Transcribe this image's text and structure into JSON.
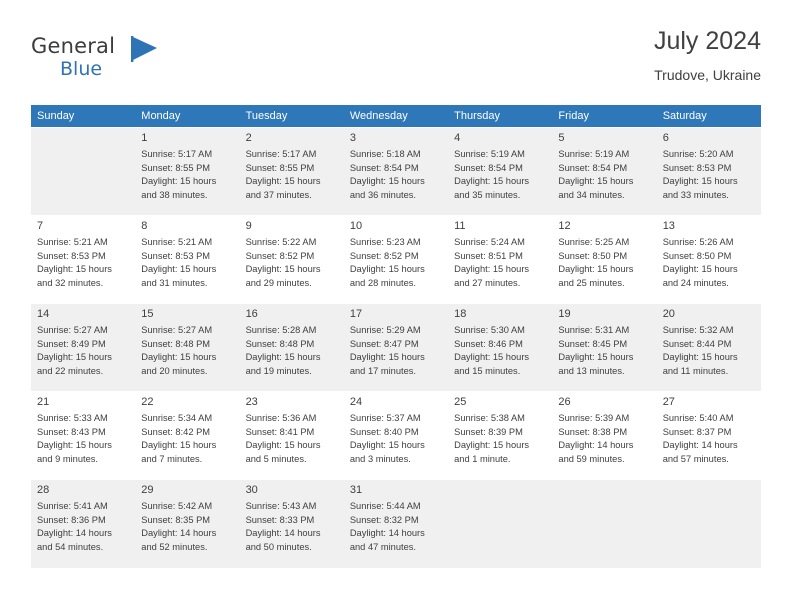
{
  "brand": {
    "name_primary": "General",
    "name_secondary": "Blue",
    "flag_icon": "flag-icon"
  },
  "header": {
    "title": "July 2024",
    "subtitle": "Trudove, Ukraine"
  },
  "colors": {
    "header_row": "#2e77b8",
    "brand_blue": "#2e74b5",
    "shaded_row": "#f0f0f0",
    "text": "#3f3f3f"
  },
  "weekdays": [
    "Sunday",
    "Monday",
    "Tuesday",
    "Wednesday",
    "Thursday",
    "Friday",
    "Saturday"
  ],
  "weeks": [
    [
      {
        "day": "",
        "detail": ""
      },
      {
        "day": "1",
        "detail": "Sunrise: 5:17 AM\nSunset: 8:55 PM\nDaylight: 15 hours\nand 38 minutes."
      },
      {
        "day": "2",
        "detail": "Sunrise: 5:17 AM\nSunset: 8:55 PM\nDaylight: 15 hours\nand 37 minutes."
      },
      {
        "day": "3",
        "detail": "Sunrise: 5:18 AM\nSunset: 8:54 PM\nDaylight: 15 hours\nand 36 minutes."
      },
      {
        "day": "4",
        "detail": "Sunrise: 5:19 AM\nSunset: 8:54 PM\nDaylight: 15 hours\nand 35 minutes."
      },
      {
        "day": "5",
        "detail": "Sunrise: 5:19 AM\nSunset: 8:54 PM\nDaylight: 15 hours\nand 34 minutes."
      },
      {
        "day": "6",
        "detail": "Sunrise: 5:20 AM\nSunset: 8:53 PM\nDaylight: 15 hours\nand 33 minutes."
      }
    ],
    [
      {
        "day": "7",
        "detail": "Sunrise: 5:21 AM\nSunset: 8:53 PM\nDaylight: 15 hours\nand 32 minutes."
      },
      {
        "day": "8",
        "detail": "Sunrise: 5:21 AM\nSunset: 8:53 PM\nDaylight: 15 hours\nand 31 minutes."
      },
      {
        "day": "9",
        "detail": "Sunrise: 5:22 AM\nSunset: 8:52 PM\nDaylight: 15 hours\nand 29 minutes."
      },
      {
        "day": "10",
        "detail": "Sunrise: 5:23 AM\nSunset: 8:52 PM\nDaylight: 15 hours\nand 28 minutes."
      },
      {
        "day": "11",
        "detail": "Sunrise: 5:24 AM\nSunset: 8:51 PM\nDaylight: 15 hours\nand 27 minutes."
      },
      {
        "day": "12",
        "detail": "Sunrise: 5:25 AM\nSunset: 8:50 PM\nDaylight: 15 hours\nand 25 minutes."
      },
      {
        "day": "13",
        "detail": "Sunrise: 5:26 AM\nSunset: 8:50 PM\nDaylight: 15 hours\nand 24 minutes."
      }
    ],
    [
      {
        "day": "14",
        "detail": "Sunrise: 5:27 AM\nSunset: 8:49 PM\nDaylight: 15 hours\nand 22 minutes."
      },
      {
        "day": "15",
        "detail": "Sunrise: 5:27 AM\nSunset: 8:48 PM\nDaylight: 15 hours\nand 20 minutes."
      },
      {
        "day": "16",
        "detail": "Sunrise: 5:28 AM\nSunset: 8:48 PM\nDaylight: 15 hours\nand 19 minutes."
      },
      {
        "day": "17",
        "detail": "Sunrise: 5:29 AM\nSunset: 8:47 PM\nDaylight: 15 hours\nand 17 minutes."
      },
      {
        "day": "18",
        "detail": "Sunrise: 5:30 AM\nSunset: 8:46 PM\nDaylight: 15 hours\nand 15 minutes."
      },
      {
        "day": "19",
        "detail": "Sunrise: 5:31 AM\nSunset: 8:45 PM\nDaylight: 15 hours\nand 13 minutes."
      },
      {
        "day": "20",
        "detail": "Sunrise: 5:32 AM\nSunset: 8:44 PM\nDaylight: 15 hours\nand 11 minutes."
      }
    ],
    [
      {
        "day": "21",
        "detail": "Sunrise: 5:33 AM\nSunset: 8:43 PM\nDaylight: 15 hours\nand 9 minutes."
      },
      {
        "day": "22",
        "detail": "Sunrise: 5:34 AM\nSunset: 8:42 PM\nDaylight: 15 hours\nand 7 minutes."
      },
      {
        "day": "23",
        "detail": "Sunrise: 5:36 AM\nSunset: 8:41 PM\nDaylight: 15 hours\nand 5 minutes."
      },
      {
        "day": "24",
        "detail": "Sunrise: 5:37 AM\nSunset: 8:40 PM\nDaylight: 15 hours\nand 3 minutes."
      },
      {
        "day": "25",
        "detail": "Sunrise: 5:38 AM\nSunset: 8:39 PM\nDaylight: 15 hours\nand 1 minute."
      },
      {
        "day": "26",
        "detail": "Sunrise: 5:39 AM\nSunset: 8:38 PM\nDaylight: 14 hours\nand 59 minutes."
      },
      {
        "day": "27",
        "detail": "Sunrise: 5:40 AM\nSunset: 8:37 PM\nDaylight: 14 hours\nand 57 minutes."
      }
    ],
    [
      {
        "day": "28",
        "detail": "Sunrise: 5:41 AM\nSunset: 8:36 PM\nDaylight: 14 hours\nand 54 minutes."
      },
      {
        "day": "29",
        "detail": "Sunrise: 5:42 AM\nSunset: 8:35 PM\nDaylight: 14 hours\nand 52 minutes."
      },
      {
        "day": "30",
        "detail": "Sunrise: 5:43 AM\nSunset: 8:33 PM\nDaylight: 14 hours\nand 50 minutes."
      },
      {
        "day": "31",
        "detail": "Sunrise: 5:44 AM\nSunset: 8:32 PM\nDaylight: 14 hours\nand 47 minutes."
      },
      {
        "day": "",
        "detail": ""
      },
      {
        "day": "",
        "detail": ""
      },
      {
        "day": "",
        "detail": ""
      }
    ]
  ]
}
